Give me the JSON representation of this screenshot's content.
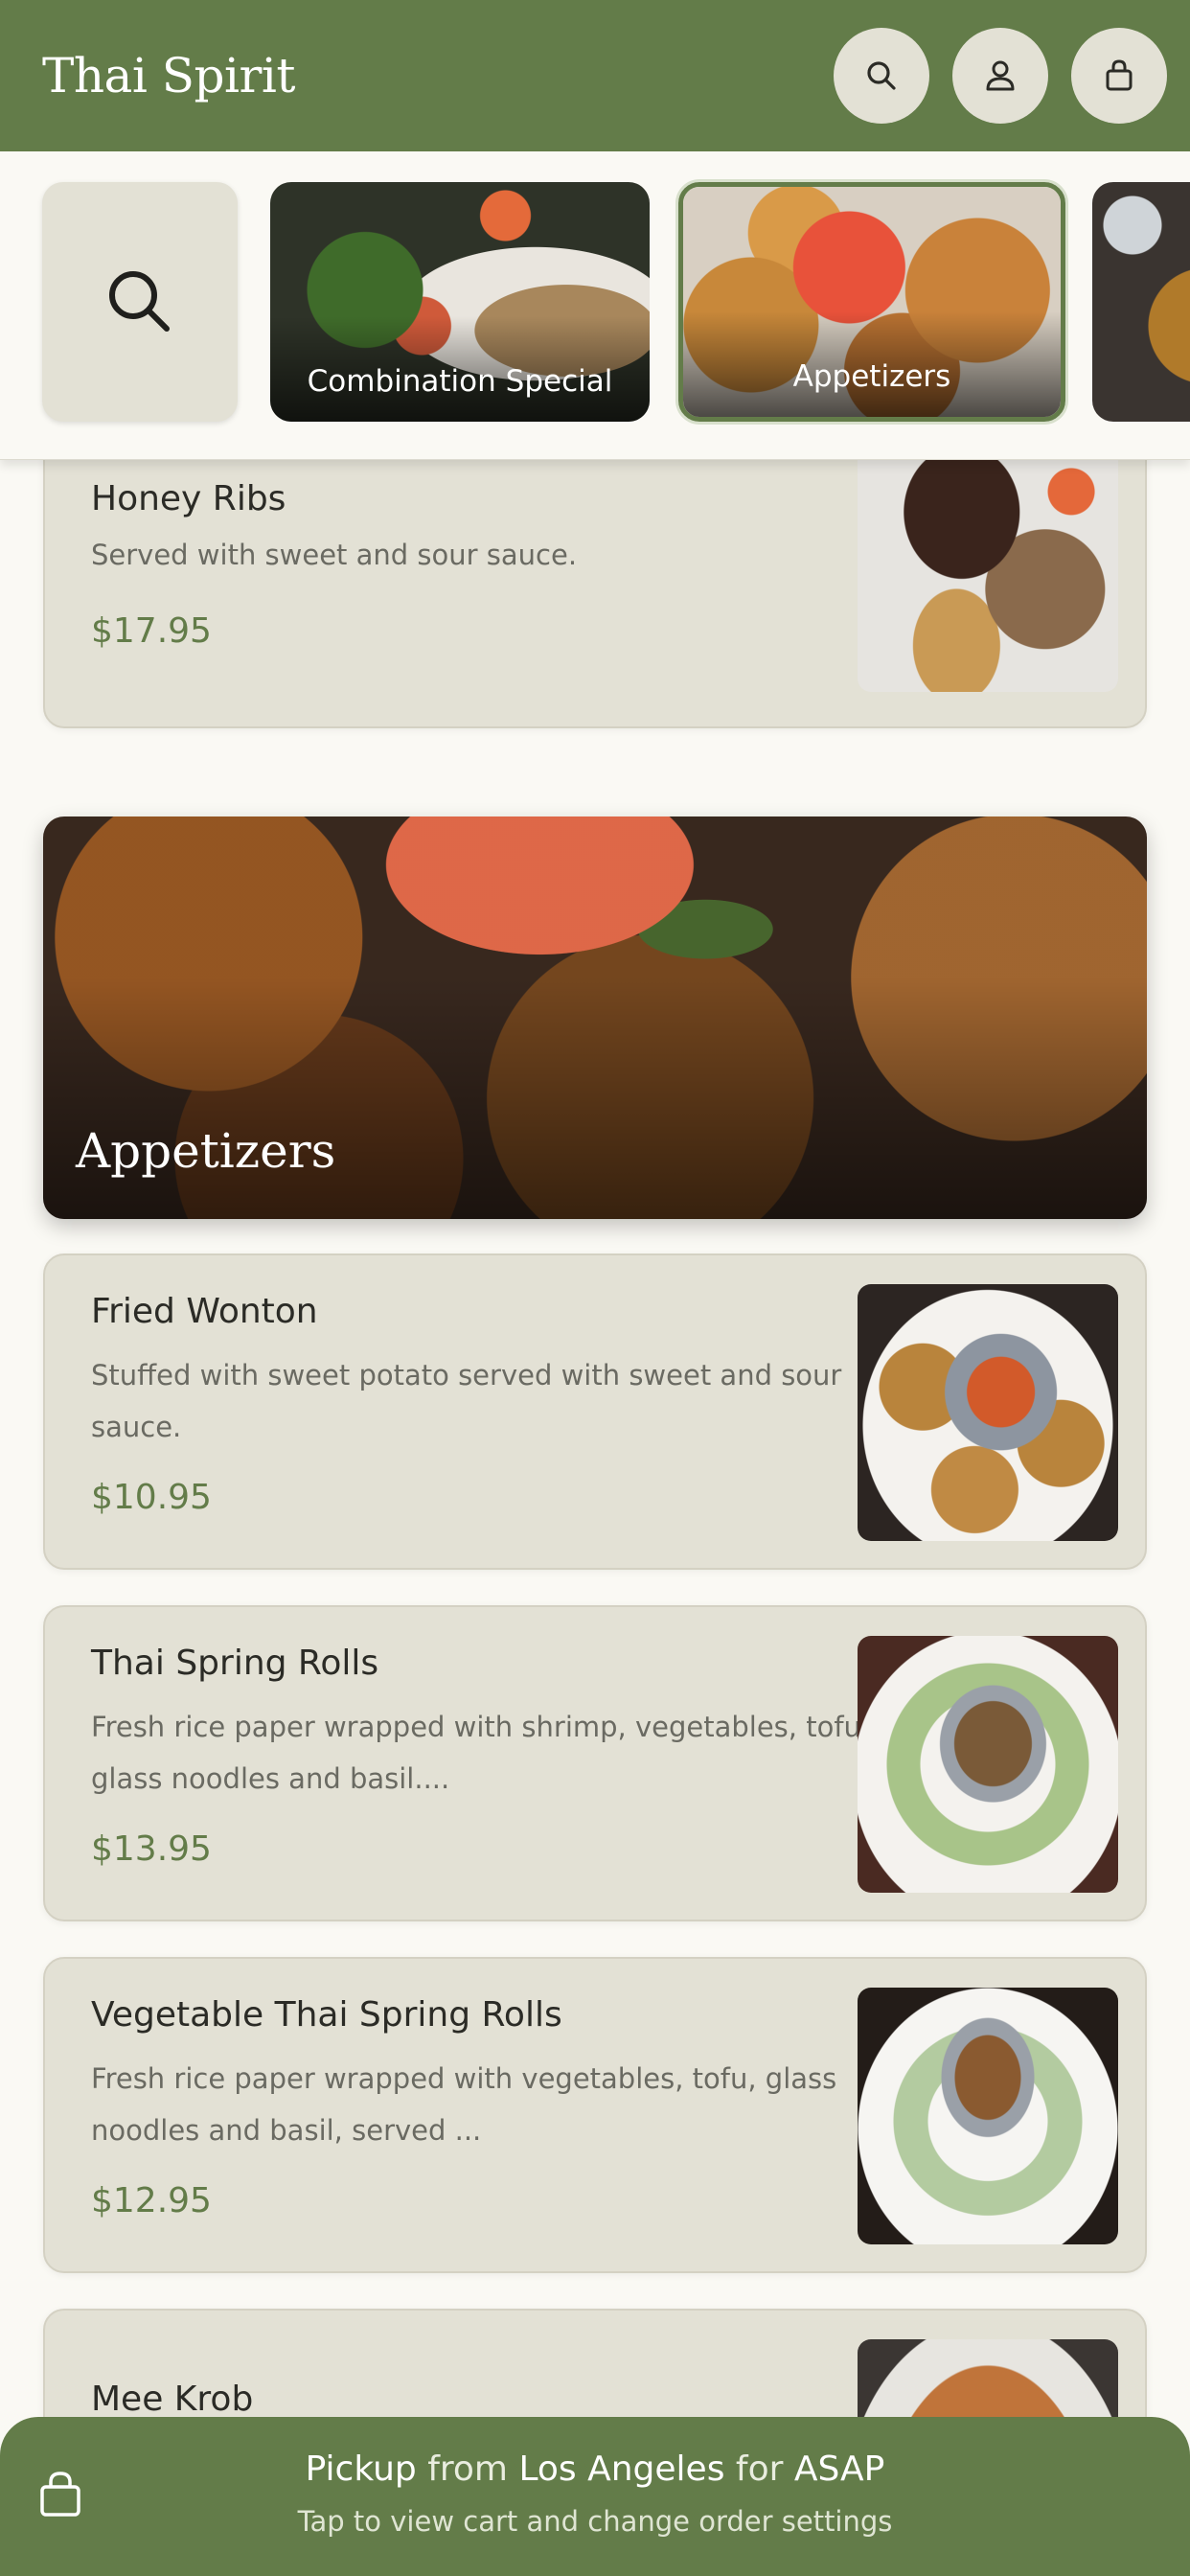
{
  "header": {
    "brand": "Thai Spirit",
    "icons": [
      "search-icon",
      "user-icon",
      "bag-icon"
    ]
  },
  "categories": [
    {
      "label": "Combination Special",
      "selected": false
    },
    {
      "label": "Appetizers",
      "selected": true
    },
    {
      "label": "",
      "selected": false
    }
  ],
  "items_prev": [
    {
      "name": "Honey Ribs",
      "desc": "Served with sweet and sour sauce.",
      "price": "$17.95"
    }
  ],
  "section": {
    "title": "Appetizers"
  },
  "items": [
    {
      "name": "Fried Wonton",
      "desc": "Stuffed with sweet potato served with sweet and sour sauce.",
      "price": "$10.95"
    },
    {
      "name": "Thai Spring Rolls",
      "desc": "Fresh rice paper wrapped with shrimp, vegetables, tofu, glass noodles and basil....",
      "price": "$13.95"
    },
    {
      "name": "Vegetable Thai Spring Rolls",
      "desc": "Fresh rice paper wrapped with vegetables, tofu, glass noodles and basil, served ...",
      "price": "$12.95"
    },
    {
      "name": "Mee Krob"
    }
  ],
  "cart_bar": {
    "pickup": "Pickup",
    "from": "from",
    "location": "Los Angeles",
    "for": "for",
    "time": "ASAP",
    "hint": "Tap to view cart and change order settings"
  },
  "colors": {
    "brand_green": "#637c49",
    "card_bg": "#e3e1d5",
    "page_bg": "#faf9f4",
    "price_green": "#637c49"
  }
}
